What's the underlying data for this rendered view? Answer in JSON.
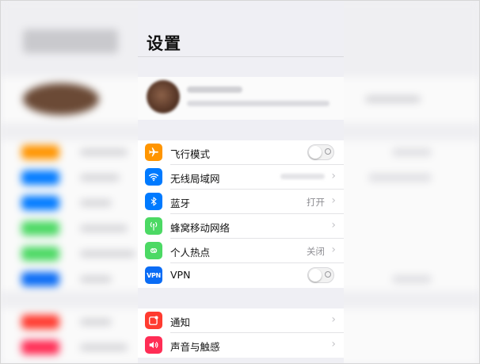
{
  "title": "设置",
  "colors": {
    "airplane": "#ff9500",
    "wifi": "#007aff",
    "bluetooth": "#007aff",
    "cellular": "#4cd964",
    "hotspot": "#4cd964",
    "vpn": "#0a6cf5",
    "notifications": "#ff3b30",
    "sounds": "#ff2d55"
  },
  "group1": [
    {
      "label": "飞行模式",
      "icon": "airplane-icon",
      "control": "toggle",
      "on": false
    },
    {
      "label": "无线局域网",
      "icon": "wifi-icon",
      "control": "chevron"
    },
    {
      "label": "蓝牙",
      "icon": "bluetooth-icon",
      "control": "chevron",
      "value": "打开"
    },
    {
      "label": "蜂窝移动网络",
      "icon": "cellular-icon",
      "control": "chevron"
    },
    {
      "label": "个人热点",
      "icon": "hotspot-icon",
      "control": "chevron",
      "value": "关闭"
    },
    {
      "label": "VPN",
      "icon": "vpn-icon",
      "icon_text": "VPN",
      "control": "toggle",
      "on": false
    }
  ],
  "group2": [
    {
      "label": "通知",
      "icon": "notifications-icon",
      "control": "chevron"
    },
    {
      "label": "声音与触感",
      "icon": "sounds-icon",
      "control": "chevron"
    }
  ]
}
